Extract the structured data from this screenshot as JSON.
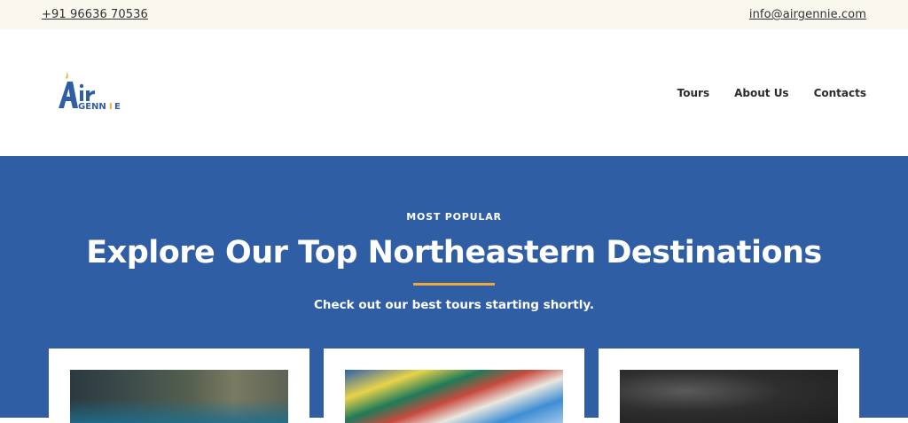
{
  "topbar": {
    "phone": "+91 96636 70536",
    "email": "info@airgennie.com"
  },
  "brand": {
    "logo_text_top": "Air",
    "logo_text_bottom": "GENNIE",
    "colors": {
      "blue": "#2f5ea5",
      "orange": "#f0a83b"
    }
  },
  "nav": {
    "items": [
      {
        "label": "Tours"
      },
      {
        "label": "About Us"
      },
      {
        "label": "Contacts"
      }
    ]
  },
  "hero": {
    "eyebrow": "MOST POPULAR",
    "title": "Explore Our Top Northeastern Destinations",
    "subtitle": "Check out our best tours starting shortly.",
    "background": "#2f5ea5"
  },
  "cards": [
    {
      "image": "cliff-lake-photo"
    },
    {
      "image": "prayer-flags-photo"
    },
    {
      "image": "dark-landscape-photo"
    }
  ]
}
